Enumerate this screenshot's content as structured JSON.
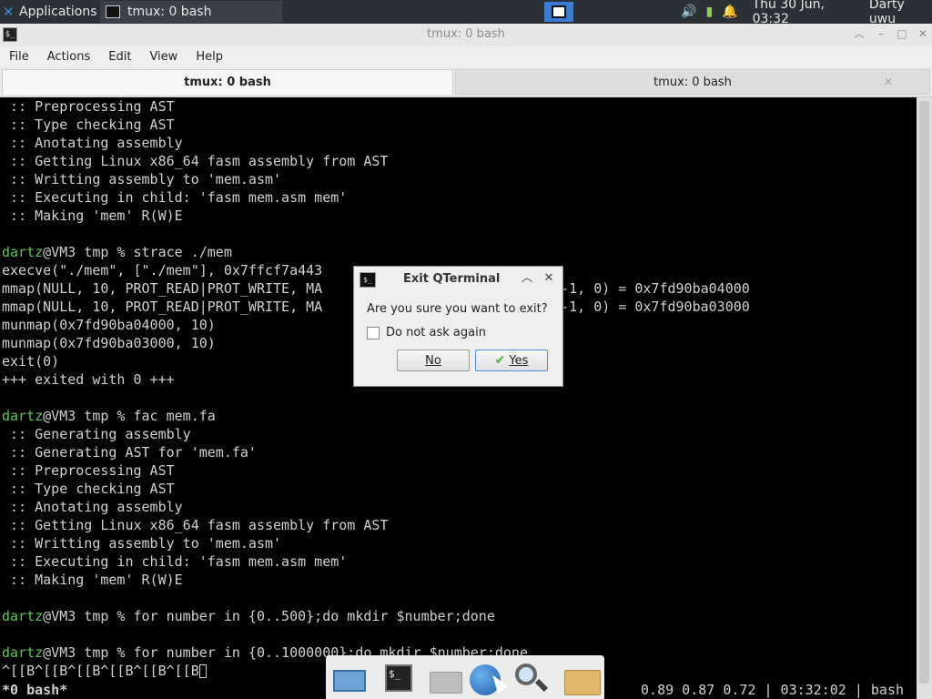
{
  "top_panel": {
    "applications_label": "Applications",
    "task_label": "tmux: 0 bash",
    "clock": "Thu 30 Jun, 03:32",
    "user": "Darty uwu"
  },
  "window": {
    "title": "tmux: 0 bash"
  },
  "menubar": {
    "items": [
      "File",
      "Actions",
      "Edit",
      "View",
      "Help"
    ]
  },
  "tabs": [
    {
      "label": "tmux: 0 bash",
      "active": true
    },
    {
      "label": "tmux: 0 bash",
      "active": false
    }
  ],
  "terminal": {
    "lines": [
      " :: Preprocessing AST",
      " :: Type checking AST",
      " :: Anotating assembly",
      " :: Getting Linux x86_64 fasm assembly from AST",
      " :: Writting assembly to 'mem.asm'",
      " :: Executing in child: 'fasm mem.asm mem'",
      " :: Making 'mem' R(W)E",
      "",
      "@VM3 tmp % strace ./mem",
      "execve(\"./mem\", [\"./mem\"], 0x7ffcf7a443",
      "mmap(NULL, 10, PROT_READ|PROT_WRITE, MA                           , -1, 0) = 0x7fd90ba04000",
      "mmap(NULL, 10, PROT_READ|PROT_WRITE, MA                           , -1, 0) = 0x7fd90ba03000",
      "munmap(0x7fd90ba04000, 10)",
      "munmap(0x7fd90ba03000, 10)",
      "exit(0)",
      "+++ exited with 0 +++",
      "",
      "@VM3 tmp % fac mem.fa",
      " :: Generating assembly",
      " :: Generating AST for 'mem.fa'",
      " :: Preprocessing AST",
      " :: Type checking AST",
      " :: Anotating assembly",
      " :: Getting Linux x86_64 fasm assembly from AST",
      " :: Writting assembly to 'mem.asm'",
      " :: Executing in child: 'fasm mem.asm mem'",
      " :: Making 'mem' R(W)E",
      "",
      "@VM3 tmp % for number in {0..500};do mkdir $number;done",
      "",
      "@VM3 tmp % for number in {0..1000000};do mkdir $number;done",
      "^[[B^[[B^[[B^[[B^[[B^[[B"
    ],
    "user": "dartz"
  },
  "tmux_status": {
    "window": "*0 bash*",
    "right": "0.89 0.87 0.72 | 03:32:02 | bash"
  },
  "dialog": {
    "title": "Exit QTerminal",
    "question": "Are you sure you want to exit?",
    "checkbox_label": "Do not ask again",
    "no_label": "No",
    "yes_label": "Yes"
  },
  "dock": {
    "items": [
      "desktop-icon",
      "terminal-icon",
      "home-icon",
      "browser-icon",
      "search-icon",
      "folder-icon"
    ]
  }
}
